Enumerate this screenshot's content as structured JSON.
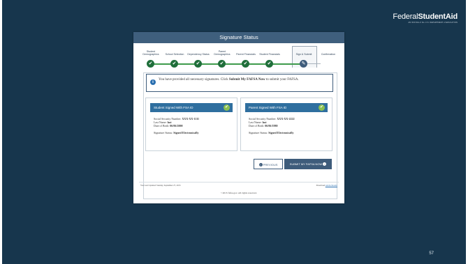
{
  "brand": {
    "name_plain": "Federal",
    "name_bold": "StudentAid",
    "tagline": "AN OFFICE of the U.S. DEPARTMENT of EDUCATION"
  },
  "slide_number": "57",
  "window": {
    "title": "Signature Status"
  },
  "steps": [
    {
      "label": "Student Demographics",
      "status": "complete"
    },
    {
      "label": "School Selection",
      "status": "complete"
    },
    {
      "label": "Dependency Status",
      "status": "complete"
    },
    {
      "label": "Parent Demographics",
      "status": "complete"
    },
    {
      "label": "Parent Financials",
      "status": "complete"
    },
    {
      "label": "Student Financials",
      "status": "complete"
    },
    {
      "label": "Sign & Submit",
      "status": "current"
    },
    {
      "label": "Confirmation",
      "status": "pending"
    }
  ],
  "alert": {
    "text_before": "You have provided all necessary signatures. Click ",
    "text_bold": "Submit My FAFSA Now",
    "text_after": " to submit your FAFSA."
  },
  "student_card": {
    "header": "Student Signed With FSA ID",
    "ssn_label": "Social Security Number:",
    "ssn_value": "XXX-XX-1111",
    "last_name_label": "Last Name:",
    "last_name_value": "last",
    "dob_label": "Date of Birth:",
    "dob_value": "06/06/2000",
    "status_label": "Signature Status:",
    "status_value": "Signed Electronically"
  },
  "parent_card": {
    "header": "Parent Signed With FSA ID",
    "ssn_label": "Social Security Number:",
    "ssn_value": "XXX-XX-2222",
    "last_name_label": "Last Name:",
    "last_name_value": "last",
    "dob_label": "Date of Birth:",
    "dob_value": "06/06/1980",
    "status_label": "Signature Status:",
    "status_value": "Signed Electronically"
  },
  "buttons": {
    "previous": "PREVIOUS",
    "submit": "SUBMIT MY FAFSA NOW"
  },
  "footer": {
    "last_updated": "You Last Updated: Sunday, September 27, 2015",
    "download_prefix": "Download",
    "download_link": "Adobe Reader",
    "copyright": "©2015 fafsa.gov. All rights reserved."
  },
  "colors": {
    "slide_bg": "#17364d",
    "titlebar": "#3f5f7d",
    "card_header": "#2f6f9f",
    "step_complete": "#1f6e3a",
    "check_green": "#8bc04f"
  }
}
